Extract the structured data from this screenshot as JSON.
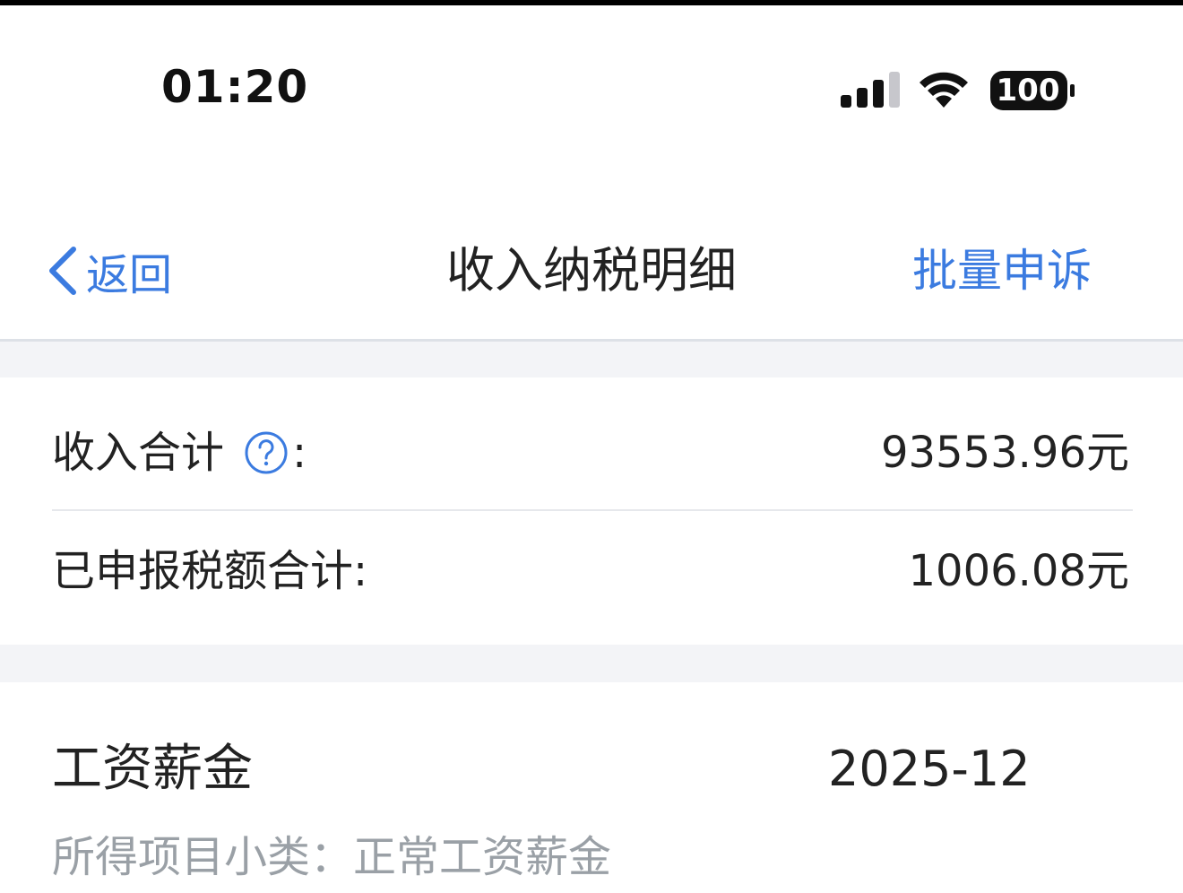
{
  "status_bar": {
    "time": "01:20",
    "battery": "100",
    "icons": [
      "signal-icon",
      "wifi-icon",
      "battery-icon"
    ]
  },
  "nav": {
    "back_label": "返回",
    "back_icon": "chevron-left-icon",
    "title": "收入纳税明细",
    "action_label": "批量申诉"
  },
  "summary": {
    "income_total_label": "收入合计",
    "income_total_colon": ":",
    "income_help_icon": "question-circle-icon",
    "income_total_value": "93553.96元",
    "tax_total_label": "已申报税额合计:",
    "tax_total_value": "1006.08元"
  },
  "records": [
    {
      "title": "工资薪金",
      "date": "2025-12",
      "subcategory": "所得项目小类：正常工资薪金"
    }
  ],
  "colors": {
    "accent": "#3b7be0",
    "text_primary": "#222222",
    "text_secondary": "#9aa0a6",
    "section_gap": "#f3f4f7",
    "divider": "#e6e8ec"
  }
}
